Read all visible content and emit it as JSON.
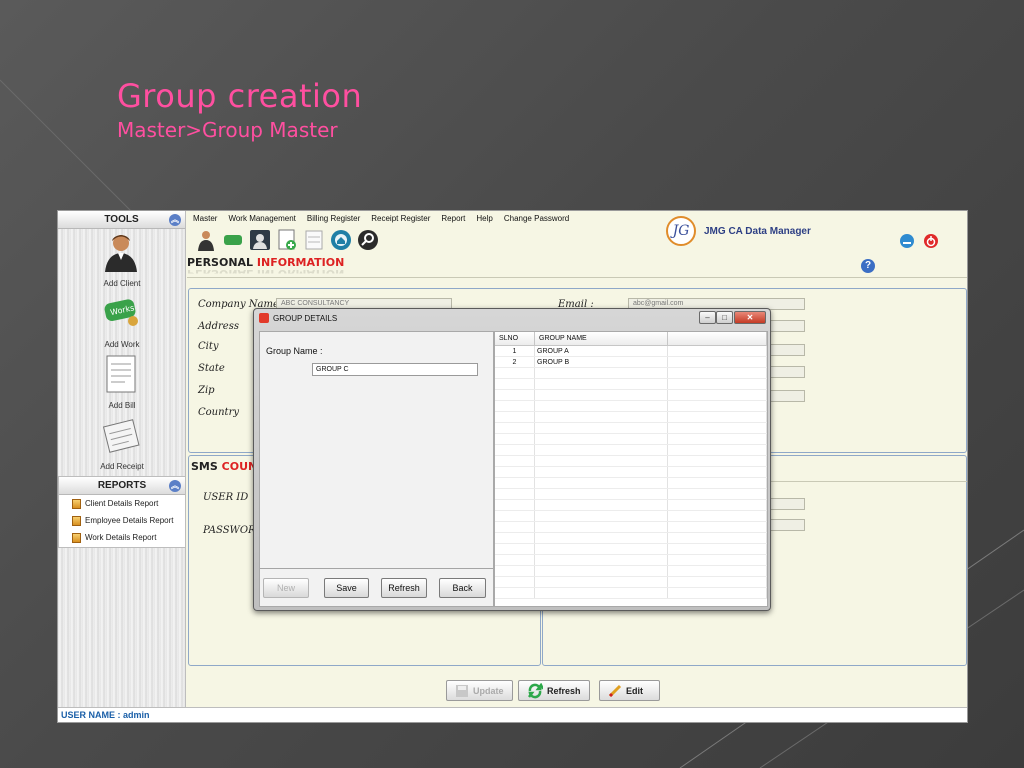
{
  "slide": {
    "title": "Group creation",
    "subtitle": "Master>Group Master"
  },
  "app": {
    "menu": [
      "Master",
      "Work Management",
      "Billing Register",
      "Receipt Register",
      "Report",
      "Help",
      "Change Password"
    ],
    "brand": "JMG CA Data Manager",
    "brand_logo": "JG",
    "tools_header": "TOOLS",
    "tools": [
      {
        "label": "Add Client",
        "icon": "client-avatar-icon"
      },
      {
        "label": "Add Work",
        "icon": "works-icon"
      },
      {
        "label": "Add Bill",
        "icon": "bill-icon"
      },
      {
        "label": "Add Receipt",
        "icon": "receipt-icon"
      }
    ],
    "reports_header": "REPORTS",
    "reports": [
      "Client Details Report",
      "Employee Details Report",
      "Work Details Report"
    ],
    "personal_section": {
      "title_a": "PERSONAL",
      "title_b": "INFORMATION"
    },
    "sms_section": {
      "title_a": "SMS",
      "title_b": "COUN"
    },
    "fields": {
      "company_name_label": "Company Name",
      "company_name_value": "ABC CONSULTANCY",
      "address_label": "Address",
      "city_label": "City",
      "state_label": "State",
      "zip_label": "Zip",
      "country_label": "Country",
      "email_label": "Email    :",
      "email_value": "abc@gmail.com",
      "userid_label": "USER ID",
      "password_label": "PASSWORD"
    },
    "bottom_buttons": {
      "update": "Update",
      "refresh": "Refresh",
      "edit": "Edit"
    },
    "status": "USER NAME :  admin"
  },
  "dialog": {
    "title": "GROUP DETAILS",
    "group_name_label": "Group Name   :",
    "group_name_value": "GROUP C",
    "buttons": {
      "new": "New",
      "save": "Save",
      "refresh": "Refresh",
      "back": "Back"
    },
    "grid": {
      "columns": [
        "SLNO",
        "GROUP NAME"
      ],
      "rows": [
        {
          "slno": "1",
          "name": "GROUP A"
        },
        {
          "slno": "2",
          "name": "GROUP B"
        }
      ]
    }
  },
  "colors": {
    "title": "#ff4fa0",
    "accent_red": "#dd2222",
    "status_blue": "#1a5fa8"
  }
}
